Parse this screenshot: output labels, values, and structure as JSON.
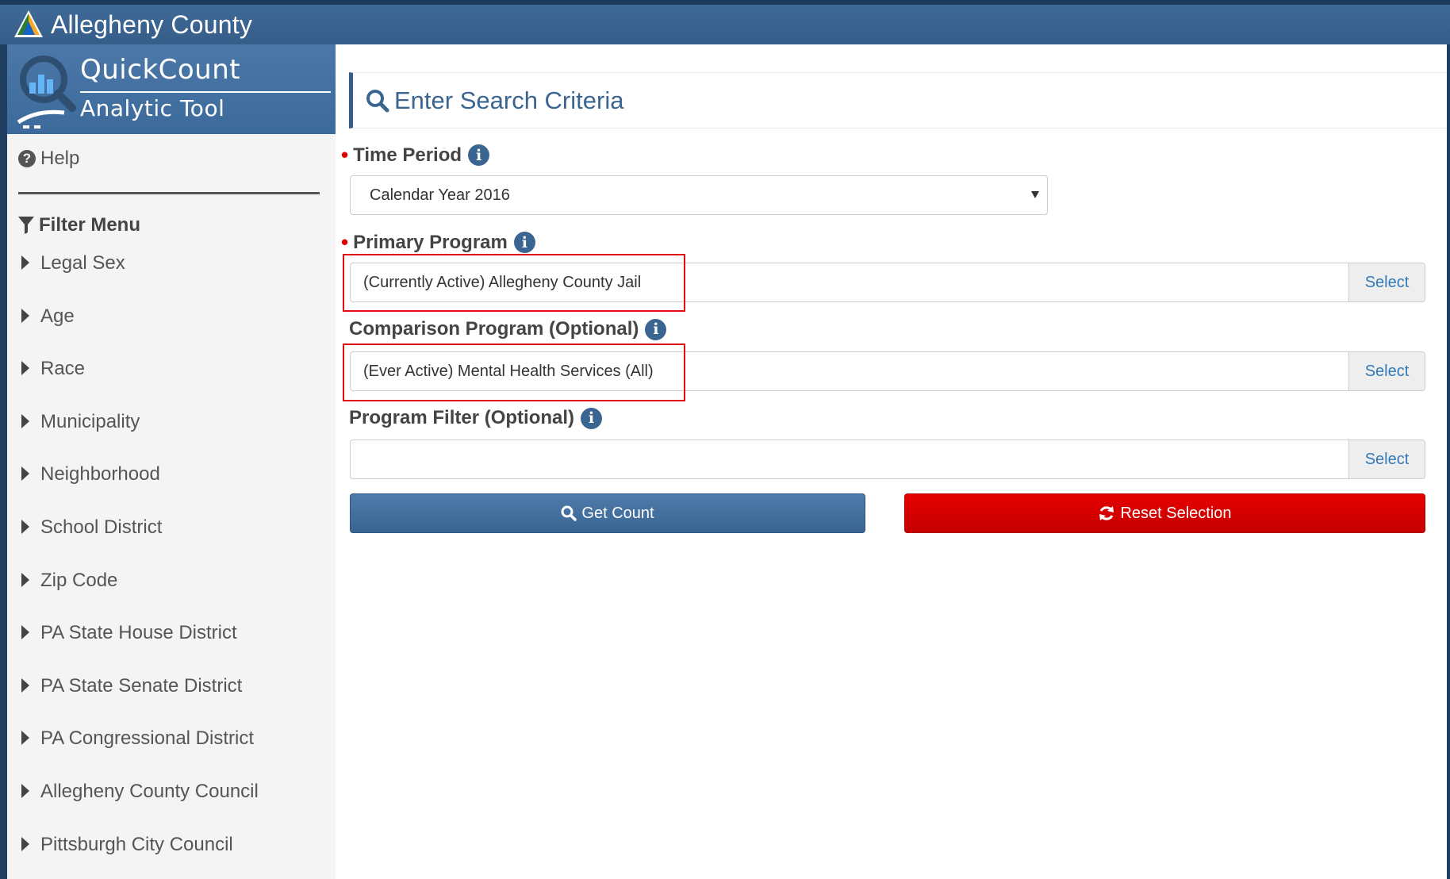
{
  "app": {
    "title": "Allegheny County"
  },
  "brand": {
    "name": "QuickCount",
    "subtitle": "Analytic Tool"
  },
  "sidebar": {
    "help_label": "Help",
    "filter_menu_label": "Filter Menu",
    "filters": [
      "Legal Sex",
      "Age",
      "Race",
      "Municipality",
      "Neighborhood",
      "School District",
      "Zip Code",
      "PA State House District",
      "PA State Senate District",
      "PA Congressional District",
      "Allegheny County Council",
      "Pittsburgh City Council"
    ]
  },
  "main": {
    "header_title": "Enter Search Criteria",
    "time_period": {
      "label": "Time Period",
      "value": "Calendar Year 2016"
    },
    "primary_program": {
      "label": "Primary Program",
      "value": "(Currently Active) Allegheny County Jail",
      "button": "Select"
    },
    "comparison_program": {
      "label": "Comparison Program (Optional)",
      "value": "(Ever Active) Mental Health Services (All)",
      "button": "Select"
    },
    "program_filter": {
      "label": "Program Filter (Optional)",
      "value": "",
      "button": "Select"
    },
    "get_count_label": "Get Count",
    "reset_label": "Reset Selection"
  },
  "colors": {
    "brand_blue": "#355d89",
    "reset_red": "#d40000",
    "highlight_red": "#e10f0f"
  }
}
